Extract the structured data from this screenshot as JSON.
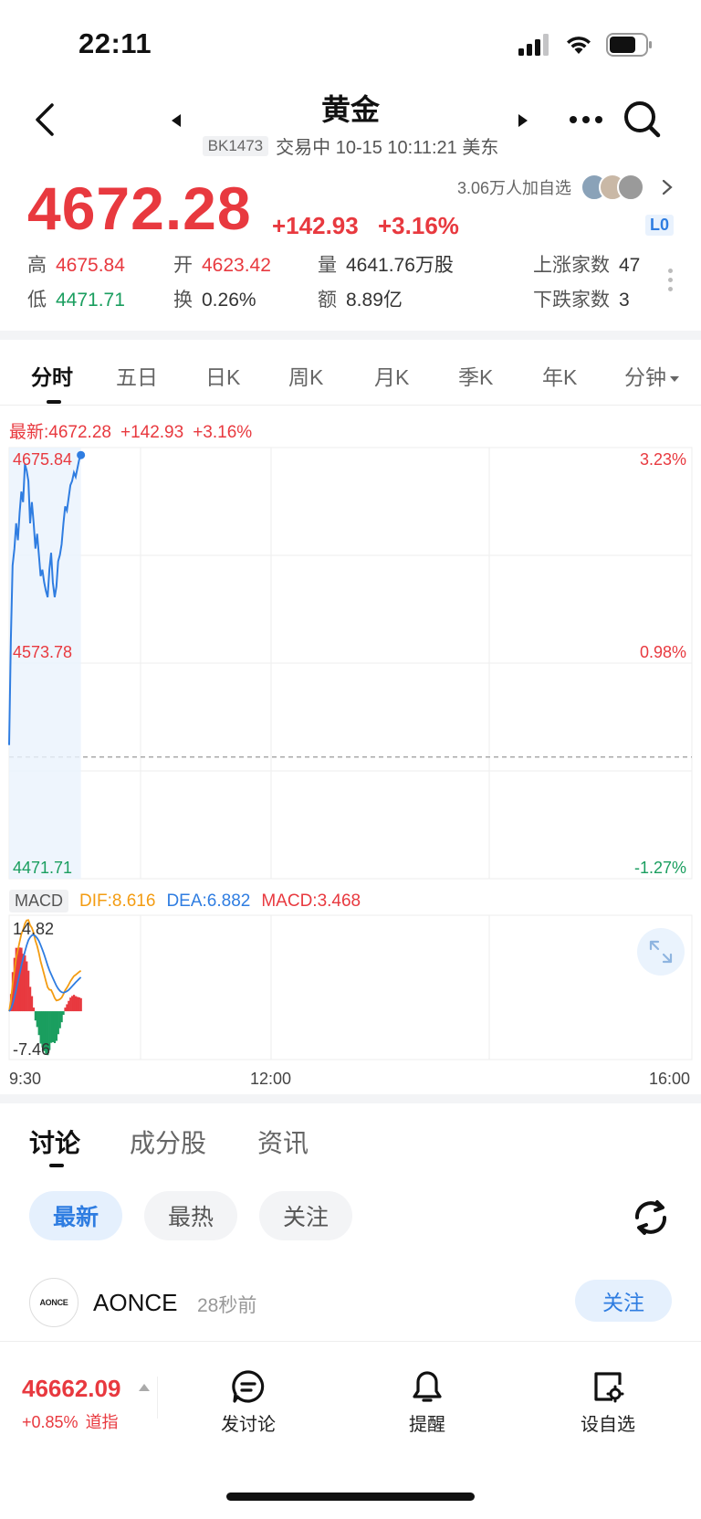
{
  "status": {
    "time": "22:11"
  },
  "header": {
    "title": "黄金",
    "code": "BK1473",
    "trade_status": "交易中 10-15 10:11:21 美东"
  },
  "quote": {
    "price": "4672.28",
    "change": "+142.93",
    "change_pct": "+3.16%",
    "watchers": "3.06万人加自选",
    "level_badge": "L0",
    "stats": {
      "high_label": "高",
      "high": "4675.84",
      "open_label": "开",
      "open": "4623.42",
      "volume_label": "量",
      "volume": "4641.76万股",
      "up_count_label": "上涨家数",
      "up_count": "47",
      "low_label": "低",
      "low": "4471.71",
      "turnover_label": "换",
      "turnover": "0.26%",
      "amount_label": "额",
      "amount": "8.89亿",
      "down_count_label": "下跌家数",
      "down_count": "3"
    }
  },
  "chart_tabs": [
    "分时",
    "五日",
    "日K",
    "周K",
    "月K",
    "季K",
    "年K",
    "分钟"
  ],
  "chart": {
    "latest_label": "最新:4672.28",
    "latest_change": "+142.93",
    "latest_pct": "+3.16%",
    "y_high": "4675.84",
    "y_mid": "4573.78",
    "y_low": "4471.71",
    "pct_high": "3.23%",
    "pct_mid": "0.98%",
    "pct_low": "-1.27%",
    "macd_badge": "MACD",
    "dif": "DIF:8.616",
    "dea": "DEA:6.882",
    "macd": "MACD:3.468",
    "macd_high": "14.82",
    "macd_low": "-7.46",
    "time_start": "9:30",
    "time_mid": "12:00",
    "time_end": "16:00"
  },
  "chart_data": {
    "type": "line",
    "x": [
      "9:30",
      "9:31",
      "9:32",
      "9:33",
      "9:34",
      "9:35",
      "9:36",
      "9:37",
      "9:38",
      "9:39",
      "9:40",
      "9:41",
      "9:42",
      "9:43",
      "9:44",
      "9:45",
      "9:46",
      "9:47",
      "9:48",
      "9:49",
      "9:50",
      "9:51",
      "9:52",
      "9:53",
      "9:54",
      "9:55",
      "9:56",
      "9:57",
      "9:58",
      "9:59",
      "10:00",
      "10:01",
      "10:02",
      "10:03",
      "10:04",
      "10:05",
      "10:06",
      "10:07",
      "10:08",
      "10:09",
      "10:10",
      "10:11"
    ],
    "series": [
      {
        "values": [
          4535,
          4585,
          4620,
          4628,
          4640,
          4632,
          4645,
          4655,
          4650,
          4668,
          4665,
          4660,
          4640,
          4650,
          4640,
          4628,
          4635,
          4625,
          4615,
          4618,
          4612,
          4608,
          4605,
          4618,
          4626,
          4612,
          4605,
          4610,
          4622,
          4625,
          4630,
          4640,
          4648,
          4646,
          4652,
          4658,
          4660,
          4664,
          4662,
          4666,
          4670,
          4672.28
        ]
      }
    ],
    "ylim": [
      4471.71,
      4675.84
    ],
    "xlim": [
      "9:30",
      "16:00"
    ],
    "prev_close": 4529.35,
    "macd": {
      "dif": 8.616,
      "dea": 6.882,
      "macd": 3.468,
      "ylim": [
        -7.46,
        14.82
      ]
    }
  },
  "sections": {
    "tabs": [
      "讨论",
      "成分股",
      "资讯"
    ],
    "filters": [
      "最新",
      "最热",
      "关注"
    ]
  },
  "post": {
    "avatar_text": "AONCE",
    "name": "AONCE",
    "time": "28秒前",
    "follow": "关注"
  },
  "bottom": {
    "index_value": "46662.09",
    "index_pct": "+0.85%",
    "index_name": "道指",
    "nav": [
      "发讨论",
      "提醒",
      "设自选"
    ]
  },
  "colors": {
    "up": "#e8393f",
    "down": "#1a9e5f",
    "accent": "#2f7de1"
  }
}
